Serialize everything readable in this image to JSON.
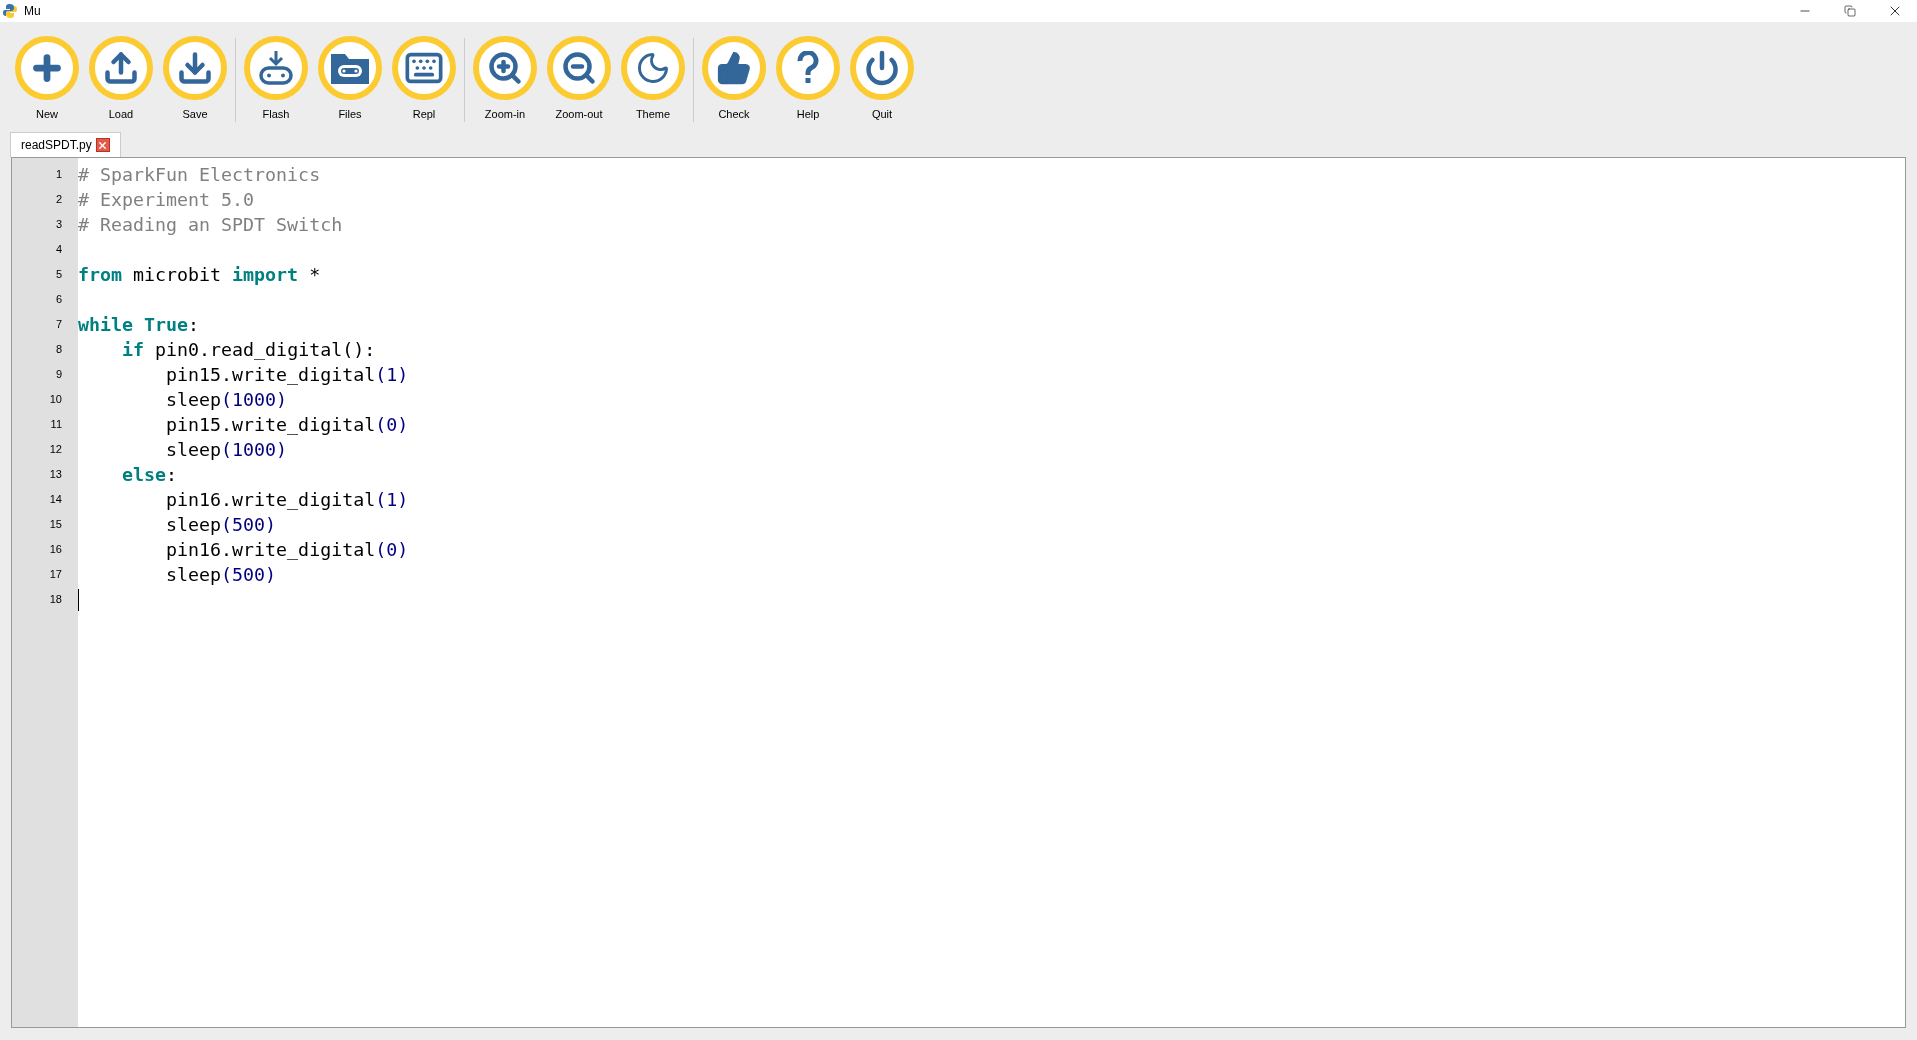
{
  "window": {
    "title": "Mu"
  },
  "toolbar_groups": [
    [
      {
        "kind": "new",
        "label": "New"
      },
      {
        "kind": "load",
        "label": "Load"
      },
      {
        "kind": "save",
        "label": "Save"
      }
    ],
    [
      {
        "kind": "flash",
        "label": "Flash"
      },
      {
        "kind": "files",
        "label": "Files"
      },
      {
        "kind": "repl",
        "label": "Repl"
      }
    ],
    [
      {
        "kind": "zoom-in",
        "label": "Zoom-in"
      },
      {
        "kind": "zoom-out",
        "label": "Zoom-out"
      },
      {
        "kind": "theme",
        "label": "Theme"
      }
    ],
    [
      {
        "kind": "check",
        "label": "Check"
      },
      {
        "kind": "help",
        "label": "Help"
      },
      {
        "kind": "quit",
        "label": "Quit"
      }
    ]
  ],
  "tabs": [
    {
      "label": "readSPDT.py",
      "selected": true
    }
  ],
  "editor": {
    "lines": [
      {
        "number": "1",
        "cursor": false,
        "tokens": [
          {
            "kind": "comment",
            "text": "# SparkFun Electronics"
          }
        ]
      },
      {
        "number": "2",
        "cursor": false,
        "tokens": [
          {
            "kind": "comment",
            "text": "# Experiment 5.0"
          }
        ]
      },
      {
        "number": "3",
        "cursor": false,
        "tokens": [
          {
            "kind": "comment",
            "text": "# Reading an SPDT Switch"
          }
        ]
      },
      {
        "number": "4",
        "cursor": false
      },
      {
        "number": "5",
        "cursor": false,
        "tokens": [
          {
            "kind": "keyword",
            "text": "from"
          },
          {
            "kind": "plain",
            "text": " microbit "
          },
          {
            "kind": "keyword",
            "text": "import"
          },
          {
            "kind": "plain",
            "text": " *"
          }
        ]
      },
      {
        "number": "6",
        "cursor": false
      },
      {
        "number": "7",
        "cursor": false,
        "tokens": [
          {
            "kind": "keyword",
            "text": "while True"
          },
          {
            "kind": "plain",
            "text": ":"
          }
        ]
      },
      {
        "number": "8",
        "cursor": false,
        "tokens": [
          {
            "kind": "keyword",
            "text": "    if"
          },
          {
            "kind": "plain",
            "text": " pin0.read_digital():"
          }
        ]
      },
      {
        "number": "9",
        "cursor": false,
        "tokens": [
          {
            "kind": "plain",
            "text": "        pin15.write_digital"
          },
          {
            "kind": "number",
            "text": "(1)"
          }
        ]
      },
      {
        "number": "10",
        "cursor": false,
        "tokens": [
          {
            "kind": "plain",
            "text": "        sleep"
          },
          {
            "kind": "number",
            "text": "(1000)"
          }
        ]
      },
      {
        "number": "11",
        "cursor": false,
        "tokens": [
          {
            "kind": "plain",
            "text": "        pin15.write_digital"
          },
          {
            "kind": "number",
            "text": "(0)"
          }
        ]
      },
      {
        "number": "12",
        "cursor": false,
        "tokens": [
          {
            "kind": "plain",
            "text": "        sleep"
          },
          {
            "kind": "number",
            "text": "(1000)"
          }
        ]
      },
      {
        "number": "13",
        "cursor": false,
        "tokens": [
          {
            "kind": "keyword",
            "text": "    else"
          },
          {
            "kind": "plain",
            "text": ":"
          }
        ]
      },
      {
        "number": "14",
        "cursor": false,
        "tokens": [
          {
            "kind": "plain",
            "text": "        pin16.write_digital"
          },
          {
            "kind": "number",
            "text": "(1)"
          }
        ]
      },
      {
        "number": "15",
        "cursor": false,
        "tokens": [
          {
            "kind": "plain",
            "text": "        sleep"
          },
          {
            "kind": "number",
            "text": "(500)"
          }
        ]
      },
      {
        "number": "16",
        "cursor": false,
        "tokens": [
          {
            "kind": "plain",
            "text": "        pin16.write_digital"
          },
          {
            "kind": "number",
            "text": "(0)"
          }
        ]
      },
      {
        "number": "17",
        "cursor": false,
        "tokens": [
          {
            "kind": "plain",
            "text": "        sleep"
          },
          {
            "kind": "number",
            "text": "(500)"
          }
        ]
      },
      {
        "number": "18",
        "cursor": true
      }
    ]
  }
}
